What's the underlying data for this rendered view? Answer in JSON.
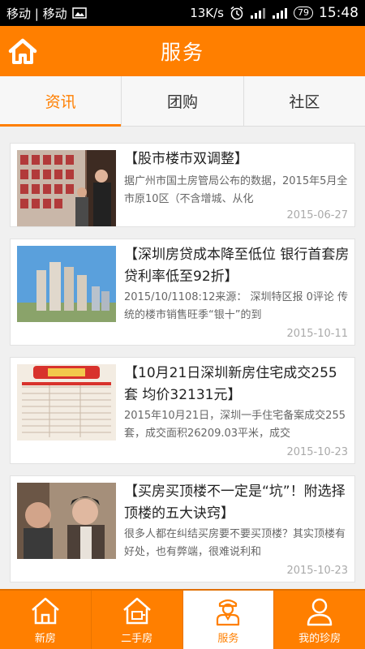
{
  "status": {
    "carrier": "移动 | 移动",
    "speed": "13K/s",
    "battery": "79",
    "time": "15:48"
  },
  "header": {
    "title": "服务"
  },
  "tabs": [
    {
      "label": "资讯"
    },
    {
      "label": "团购"
    },
    {
      "label": "社区"
    }
  ],
  "news": [
    {
      "title": "【股市楼市双调整】",
      "desc": "据广州市国土房管局公布的数据，2015年5月全市原10区（不含增城、从化",
      "date": "2015-06-27"
    },
    {
      "title": "【深圳房贷成本降至低位 银行首套房贷利率低至92折】",
      "desc": "2015/10/1108:12来源： 深圳特区报 0评论 传统的楼市销售旺季“银十”的到",
      "date": "2015-10-11"
    },
    {
      "title": "【10月21日深圳新房住宅成交255套 均价32131元】",
      "desc": "2015年10月21日，深圳一手住宅备案成交255套，成交面积26209.03平米，成交",
      "date": "2015-10-23"
    },
    {
      "title": "【买房买顶楼不一定是“坑”！附选择顶楼的五大诀窍】",
      "desc": "很多人都在纠结买房要不要买顶楼？其实顶楼有好处，也有弊端，很难说利和",
      "date": "2015-10-23"
    }
  ],
  "tabbar": [
    {
      "label": "新房",
      "icon": "house-icon"
    },
    {
      "label": "二手房",
      "icon": "second-hand-house-icon"
    },
    {
      "label": "服务",
      "icon": "service-person-icon"
    },
    {
      "label": "我的珍房",
      "icon": "user-icon"
    }
  ],
  "colors": {
    "accent": "#ff7f00"
  }
}
